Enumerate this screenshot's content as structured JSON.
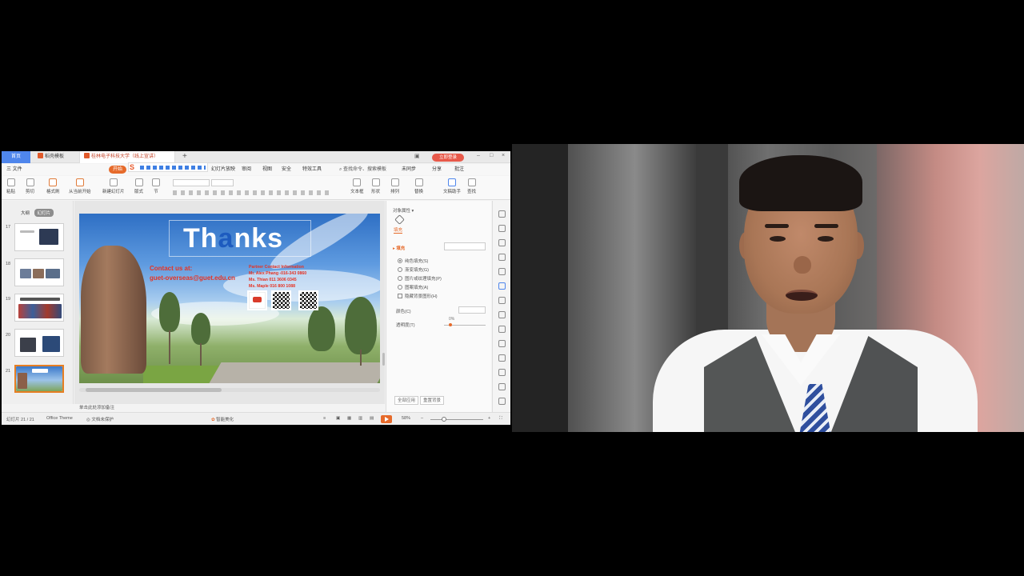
{
  "tabs": {
    "home": "首页",
    "templates": "稻壳模板",
    "document": "桂林电子科技大学（线上宣讲）",
    "login": "立即登录"
  },
  "menu": {
    "file": "三 文件",
    "start": "开始",
    "insert": "动画",
    "slideshow": "幻灯片放映",
    "review": "审阅",
    "view": "视图",
    "security": "安全",
    "special": "特效工具",
    "search": "查找命令、搜索模板",
    "collab": "未同步",
    "share": "分享",
    "annotate": "批注"
  },
  "ribbon": {
    "paste": "粘贴",
    "cut": "剪切",
    "format_painter": "格式刷",
    "from_current": "从当前开始",
    "new_slide": "新建幻灯片",
    "layout": "版式",
    "section": "节",
    "reset": "重置",
    "textbox": "文本框",
    "shape": "形状",
    "arrange": "排列",
    "replace": "替换",
    "select": "选择",
    "doc_assist": "文稿助手",
    "find": "查找"
  },
  "left_panel": {
    "outline_tab": "大纲",
    "slides_tab": "幻灯片",
    "slide_numbers": [
      "17",
      "18",
      "19",
      "20",
      "21"
    ]
  },
  "slide": {
    "title_a": "Th",
    "title_b": "a",
    "title_c": "nks",
    "contact_label": "Contact us at:",
    "contact_email": "guet-overseas@guet.edu.cn",
    "partner_lines": [
      "Partner Contact Information",
      "Mr. Alex Phang -016-343 0860",
      "Ms. Thian 011 3606 0345",
      "Ms. Maple 016 800 1088"
    ]
  },
  "notes": "单击此处添加备注",
  "right_panel": {
    "title": "对象属性 ▾",
    "fill_tab": "填充",
    "section": "▸ 填充",
    "options": [
      "纯色填充(S)",
      "渐变填充(G)",
      "图片或纹理填充(P)",
      "图案填充(A)",
      "隐藏背景图形(H)"
    ],
    "color_label": "颜色(C)",
    "transparency_label": "透明度(T)",
    "transparency_value": "0%",
    "transparency_level": 0.0,
    "apply_all": "全部应用",
    "reset_bg": "重置背景"
  },
  "status": {
    "slide_count": "幻灯片 21 / 21",
    "theme": "Office Theme",
    "doc_status": "文档未保护",
    "beautify": "智能美化",
    "zoom": "58%",
    "zoom_level": 0.58
  },
  "colors": {
    "accent": "#e66a2a",
    "tab_blue": "#4f86ec",
    "slide_red": "#e63222",
    "thanks_blue": "#1d5bbf"
  }
}
